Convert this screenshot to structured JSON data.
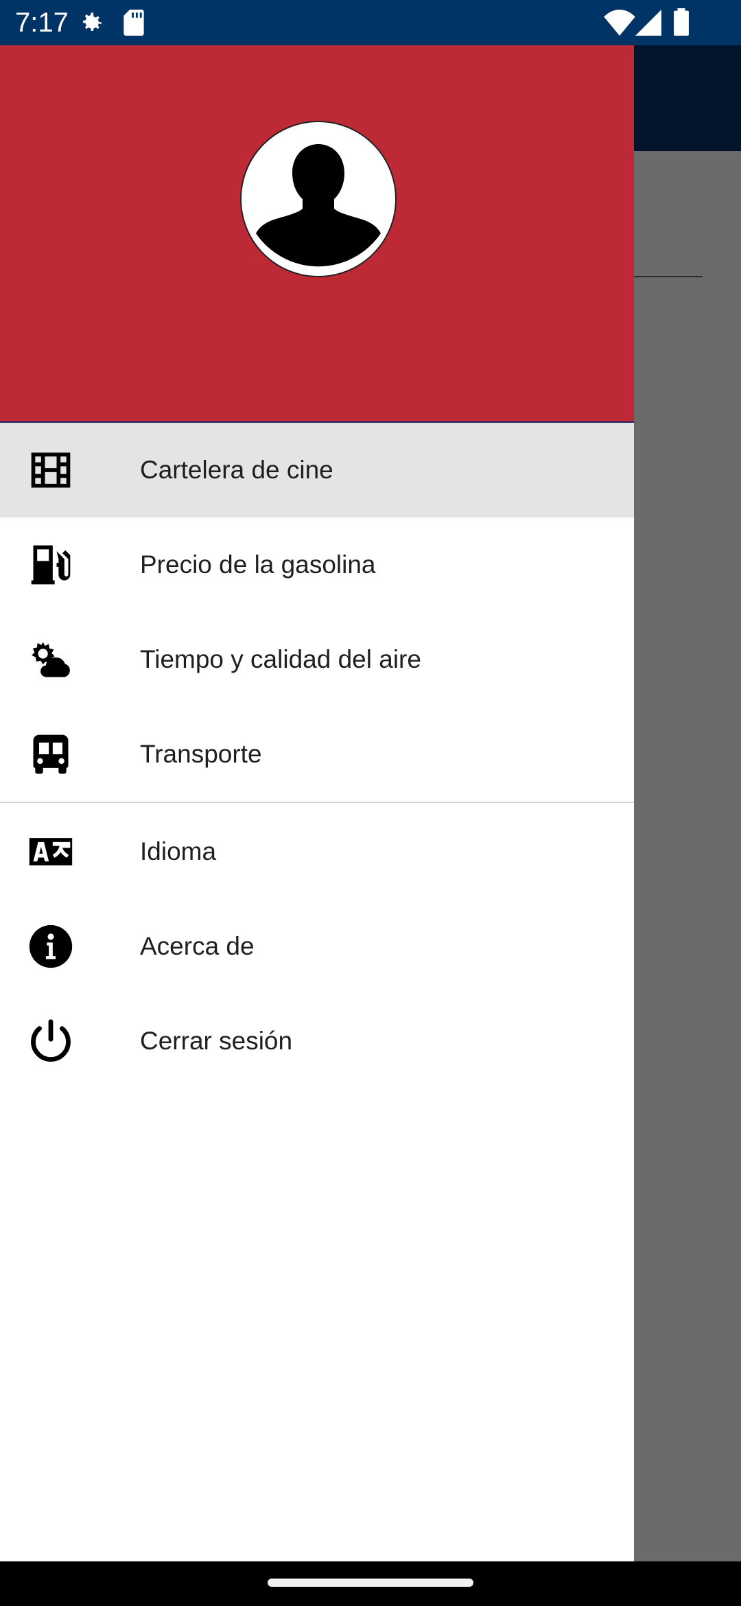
{
  "status_bar": {
    "time": "7:17",
    "icons": [
      "gear-icon",
      "sd-card-icon",
      "wifi-icon",
      "signal-icon",
      "battery-icon"
    ],
    "background": "#003366"
  },
  "drawer": {
    "header_color": "#bd2a35",
    "avatar": "profile-avatar",
    "menu_primary": [
      {
        "label": "Cartelera de cine",
        "icon": "film-icon",
        "active": true
      },
      {
        "label": "Precio de la gasolina",
        "icon": "gas-pump-icon",
        "active": false
      },
      {
        "label": "Tiempo y calidad del aire",
        "icon": "weather-icon",
        "active": false
      },
      {
        "label": "Transporte",
        "icon": "bus-icon",
        "active": false
      }
    ],
    "menu_secondary": [
      {
        "label": "Idioma",
        "icon": "language-icon"
      },
      {
        "label": "Acerca de",
        "icon": "info-icon"
      },
      {
        "label": "Cerrar sesión",
        "icon": "power-icon"
      }
    ]
  }
}
